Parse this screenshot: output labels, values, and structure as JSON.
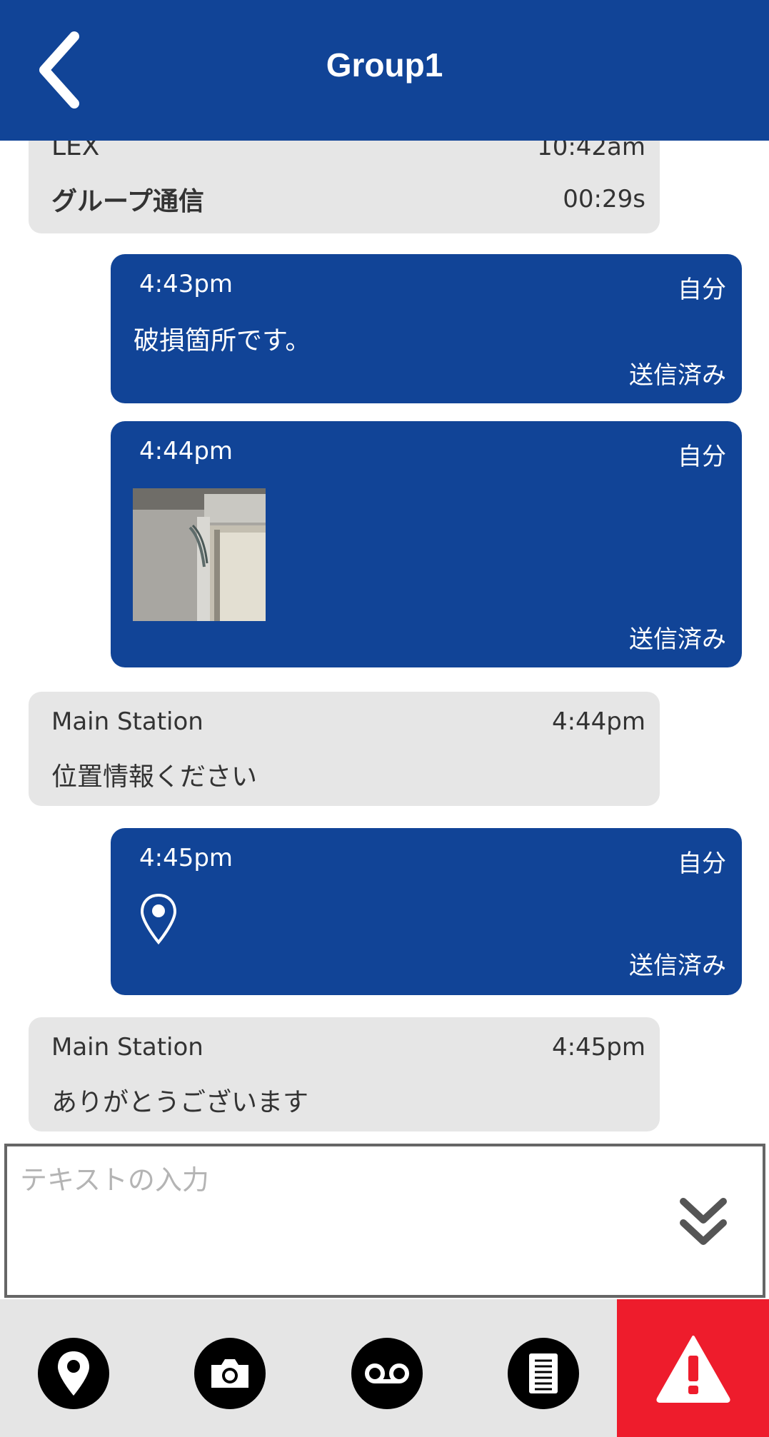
{
  "header": {
    "title": "Group1"
  },
  "messages": [
    {
      "kind": "in",
      "sender": "LEX",
      "time": "10:42am",
      "text": "グループ通信",
      "duration": "00:29s"
    },
    {
      "kind": "out",
      "time": "4:43pm",
      "who": "自分",
      "text": "破損箇所です。",
      "status": "送信済み"
    },
    {
      "kind": "out",
      "time": "4:44pm",
      "who": "自分",
      "attachment": "photo",
      "status": "送信済み"
    },
    {
      "kind": "in",
      "sender": "Main Station",
      "time": "4:44pm",
      "text": "位置情報ください"
    },
    {
      "kind": "out",
      "time": "4:45pm",
      "who": "自分",
      "attachment": "location-pin-icon",
      "status": "送信済み"
    },
    {
      "kind": "in",
      "sender": "Main Station",
      "time": "4:45pm",
      "text": "ありがとうございます"
    }
  ],
  "composer": {
    "placeholder": "テキストの入力",
    "value": ""
  },
  "toolbar": {
    "icons": [
      "location-icon",
      "camera-icon",
      "voicemail-icon",
      "document-icon",
      "alert-icon"
    ]
  },
  "colors": {
    "primary": "#114497",
    "incoming_bubble": "#e6e6e6",
    "alert": "#ee1c2c",
    "toolbar_bg": "#e5e5e5"
  }
}
